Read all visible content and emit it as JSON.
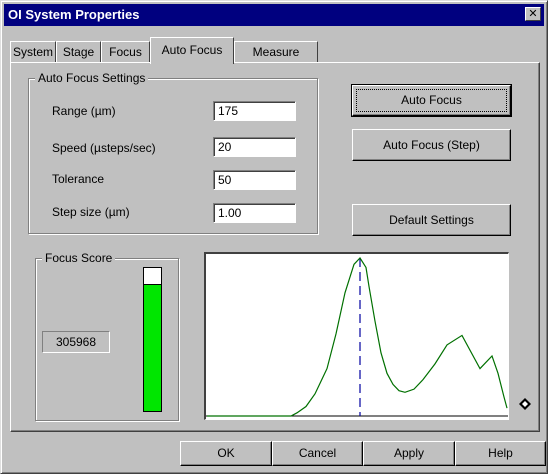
{
  "window": {
    "title": "OI System Properties",
    "close_glyph": "✕"
  },
  "tabs": [
    {
      "label": "System",
      "active": false
    },
    {
      "label": "Stage",
      "active": false
    },
    {
      "label": "Focus",
      "active": false
    },
    {
      "label": "Auto Focus",
      "active": true
    },
    {
      "label": "Measure",
      "active": false
    }
  ],
  "settings": {
    "legend": "Auto Focus Settings",
    "fields": [
      {
        "label": "Range (µm)",
        "value": "175"
      },
      {
        "label": "Speed (µsteps/sec)",
        "value": "20"
      },
      {
        "label": "Tolerance",
        "value": "50"
      },
      {
        "label": "Step size (µm)",
        "value": "1.00"
      }
    ]
  },
  "actions": {
    "auto_focus": "Auto Focus",
    "auto_focus_step": "Auto Focus (Step)",
    "default_settings": "Default Settings"
  },
  "focus_score": {
    "legend": "Focus Score",
    "value": "305968",
    "level": 0.89,
    "bar_color": "#00e600"
  },
  "chart_data": {
    "type": "line",
    "series": [
      {
        "color": "#007000",
        "x": [
          0,
          28,
          30,
          33,
          36,
          40,
          43,
          46,
          49,
          51,
          53,
          54,
          56,
          58,
          60,
          62,
          64,
          66,
          69,
          72,
          76,
          80,
          85,
          91,
          95,
          97,
          99,
          100
        ],
        "y": [
          0,
          0,
          0.02,
          0.06,
          0.14,
          0.3,
          0.52,
          0.78,
          0.96,
          1.0,
          0.94,
          0.82,
          0.6,
          0.4,
          0.27,
          0.2,
          0.16,
          0.15,
          0.17,
          0.23,
          0.33,
          0.45,
          0.51,
          0.3,
          0.38,
          0.27,
          0.12,
          0.05
        ]
      }
    ],
    "vline": {
      "x": 51,
      "color": "#0000a0",
      "style": "dashed"
    },
    "xlim": [
      0,
      100
    ],
    "ylim": [
      0,
      1
    ],
    "grid": false
  },
  "footer": {
    "ok": "OK",
    "cancel": "Cancel",
    "apply": "Apply",
    "help": "Help"
  },
  "icons": {
    "marker": "diamond-marker-icon",
    "marker_color": "#c000c0"
  }
}
